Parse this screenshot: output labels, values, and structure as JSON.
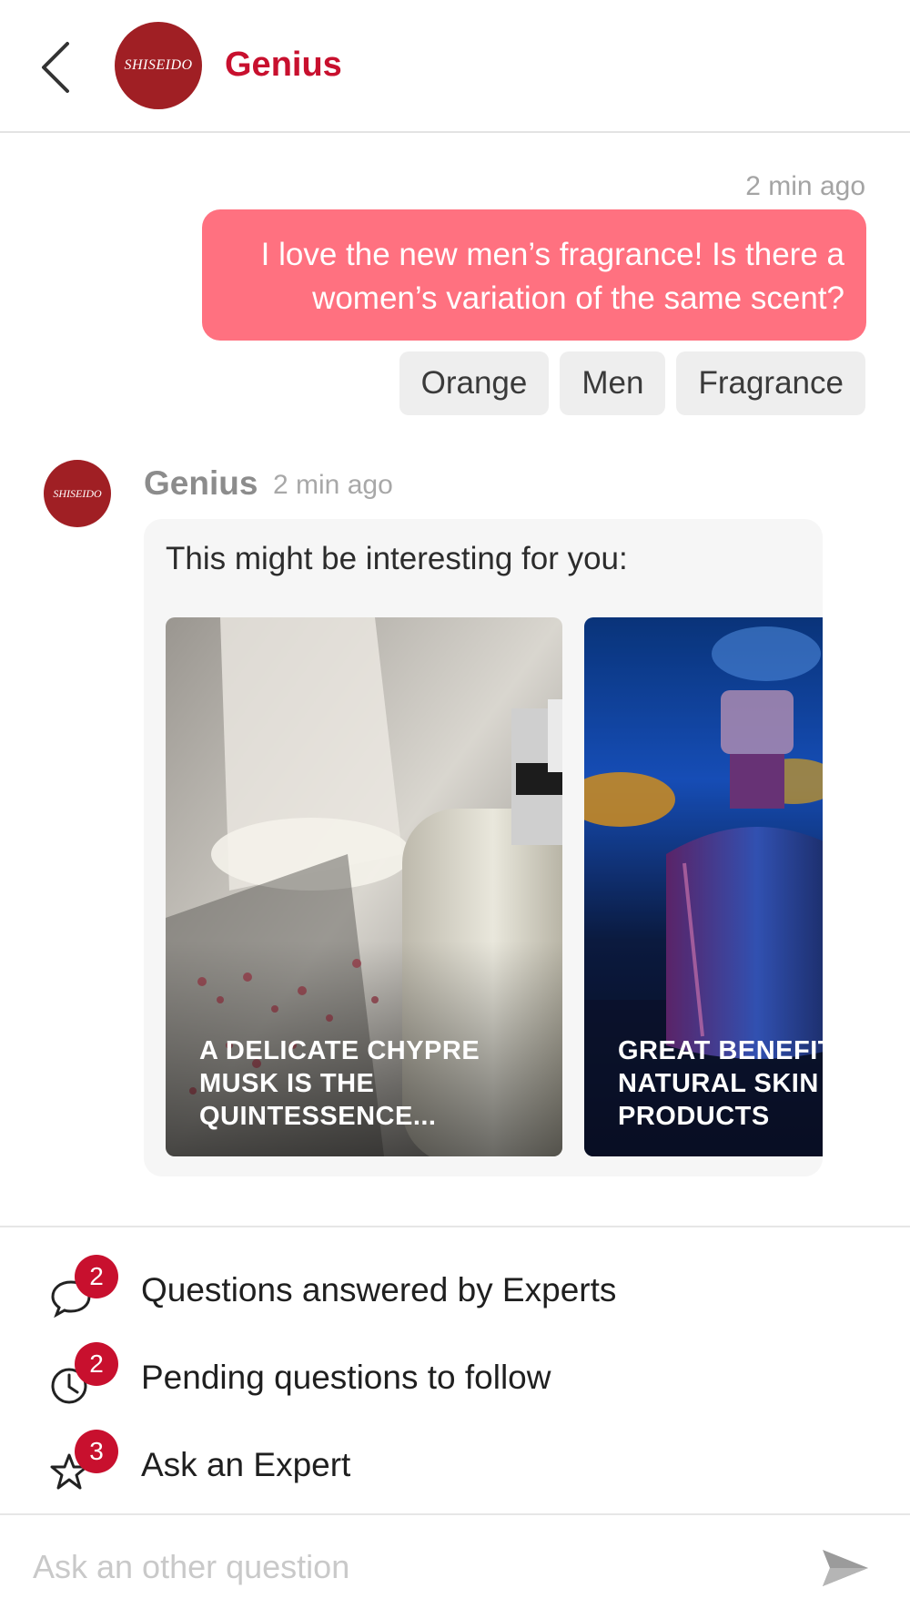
{
  "header": {
    "back_icon": "chevron-left-icon",
    "brand_logo_text": "SHISEIDO",
    "title": "Genius",
    "title_color": "#c8102e"
  },
  "conversation": {
    "user_message": {
      "time": "2 min ago",
      "text": "I love the new men’s fragrance! Is there a women’s variation of the same scent?",
      "bubble_color": "#ff7180",
      "tags": [
        "Orange",
        "Men",
        "Fragrance"
      ]
    },
    "bot_message": {
      "avatar_text": "SHISEIDO",
      "name": "Genius",
      "time": "2 min ago",
      "intro": "This might be interesting for you:",
      "cards": [
        {
          "caption": "A DELICATE CHYPRE\nMUSK IS THE\nQUINTESSENCE..."
        },
        {
          "caption": "GREAT BENEFITS\nNATURAL SKIN\nPRODUCTS"
        }
      ]
    }
  },
  "menu": {
    "items": [
      {
        "label": "Questions answered by Experts",
        "badge": "2",
        "icon": "chat-bubble-icon"
      },
      {
        "label": "Pending questions to follow",
        "badge": "2",
        "icon": "clock-icon"
      },
      {
        "label": "Ask an Expert",
        "badge": "3",
        "icon": "star-icon"
      }
    ],
    "badge_color": "#c8102e"
  },
  "composer": {
    "placeholder": "Ask an other question",
    "send_icon": "send-icon"
  }
}
